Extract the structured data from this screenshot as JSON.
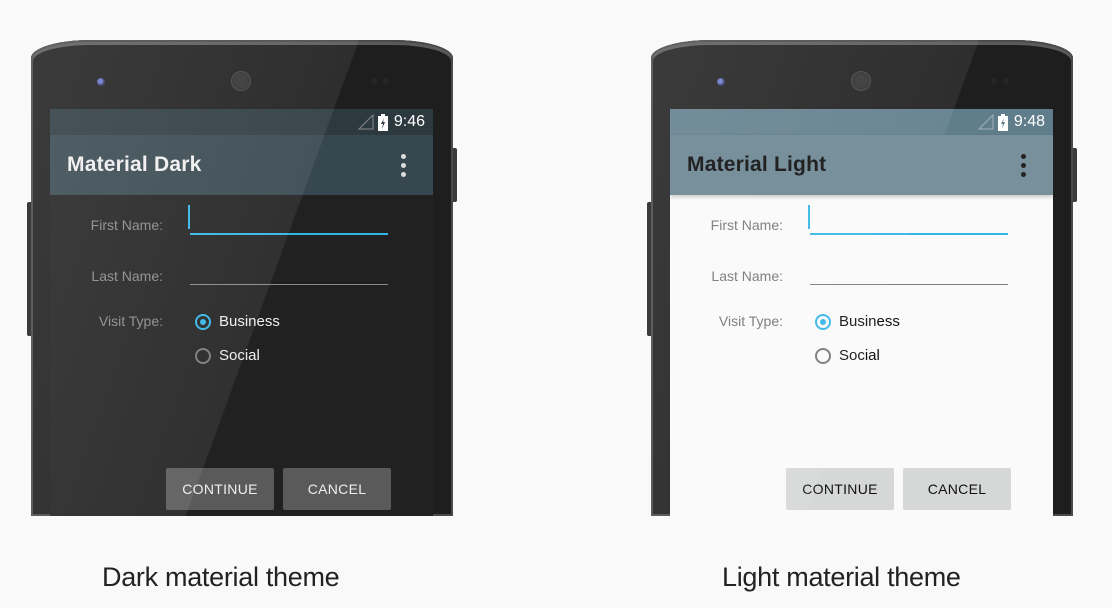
{
  "accent_color": "#33b5e5",
  "phones": {
    "dark": {
      "status": {
        "time": "9:46"
      },
      "app_title": "Material Dark",
      "form": {
        "first_name_label": "First Name:",
        "first_name_value": "",
        "last_name_label": "Last Name:",
        "last_name_value": "",
        "visit_type_label": "Visit Type:",
        "visit_options": [
          "Business",
          "Social"
        ],
        "selected_visit": "Business"
      },
      "buttons": {
        "continue": "CONTINUE",
        "cancel": "CANCEL"
      },
      "caption": "Dark material theme",
      "colors": {
        "status_bar": "#2c3a40",
        "app_bar": "#37474f",
        "background": "#212121"
      }
    },
    "light": {
      "status": {
        "time": "9:48"
      },
      "app_title": "Material Light",
      "form": {
        "first_name_label": "First Name:",
        "first_name_value": "",
        "last_name_label": "Last Name:",
        "last_name_value": "",
        "visit_type_label": "Visit Type:",
        "visit_options": [
          "Business",
          "Social"
        ],
        "selected_visit": "Business"
      },
      "buttons": {
        "continue": "CONTINUE",
        "cancel": "CANCEL"
      },
      "caption": "Light material theme",
      "colors": {
        "status_bar": "#607d8b",
        "app_bar": "#78909c",
        "background": "#fafafa"
      }
    }
  }
}
